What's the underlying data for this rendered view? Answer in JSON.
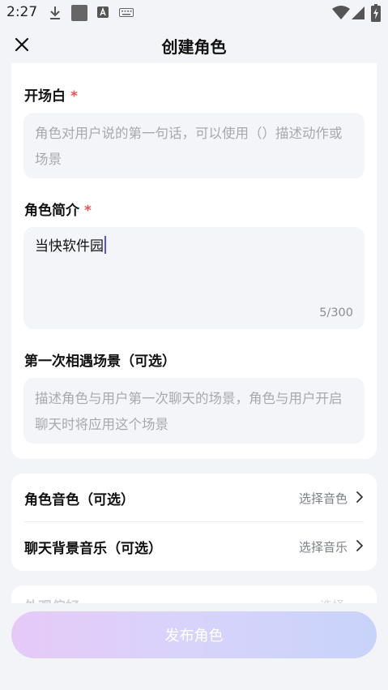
{
  "status_bar": {
    "time": "2:27",
    "icons": [
      "download-icon",
      "square-icon",
      "text-a-icon",
      "keyboard-icon",
      "wifi-icon",
      "signal-icon",
      "battery-icon"
    ]
  },
  "header": {
    "title": "创建角色",
    "close_icon": "close-icon"
  },
  "form": {
    "opening": {
      "label": "开场白",
      "required": "*",
      "placeholder": "角色对用户说的第一句话，可以使用（）描述动作或场景",
      "value": ""
    },
    "intro": {
      "label": "角色简介",
      "required": "*",
      "value": "当快软件园",
      "counter": "5/300"
    },
    "first_meet": {
      "label": "第一次相遇场景（可选）",
      "placeholder": "描述角色与用户第一次聊天的场景，角色与用户开启聊天时将应用这个场景",
      "value": ""
    }
  },
  "settings": {
    "voice": {
      "label": "角色音色（可选）",
      "value": "选择音色"
    },
    "music": {
      "label": "聊天背景音乐（可选）",
      "value": "选择音乐"
    }
  },
  "partial_row": {
    "label": "外观偏好",
    "value": "选择"
  },
  "footer": {
    "publish_label": "发布角色"
  },
  "colors": {
    "background": "#f3f4f8",
    "required": "#ff4d4f",
    "caret": "#5b4ef0",
    "button_gradient_start": "#e6c9f7",
    "button_gradient_end": "#c8d3fa"
  }
}
